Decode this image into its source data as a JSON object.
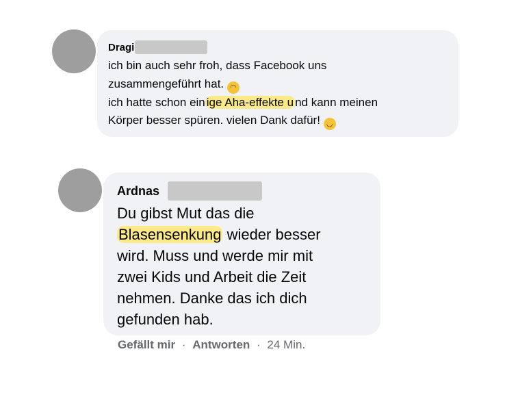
{
  "comments": [
    {
      "author": "Dragi",
      "text_parts": {
        "p1": "ich bin auch sehr froh, dass Facebook uns\nzusammengeführt hat. ",
        "p2": "\nich hatte schon ein",
        "p3": "ige Aha-effekte u",
        "p4": "nd kann meinen\nKörper besser spüren. vielen Dank dafür! "
      },
      "emoji_1": "upside-down-face-emoji",
      "emoji_2": "smiling-face-emoji"
    },
    {
      "author": "Ardnas",
      "text_parts": {
        "p1": "Du gibst Mut das die\n",
        "p2": "Blasensenkung",
        "p3": " wieder besser\nwird. Muss und werde mir mit\nzwei Kids und Arbeit die Zeit\nnehmen. Danke das ich dich\ngefunden hab."
      },
      "actions": {
        "like": "Gefällt mir",
        "reply": "Antworten",
        "separator": "·",
        "time": "24 Min."
      }
    }
  ],
  "colors": {
    "bubble": "#f0f2f5",
    "highlight": "#fbe98a",
    "avatar": "#9e9e9e",
    "redaction": "#c8c8c8",
    "meta_text": "#65676b"
  }
}
